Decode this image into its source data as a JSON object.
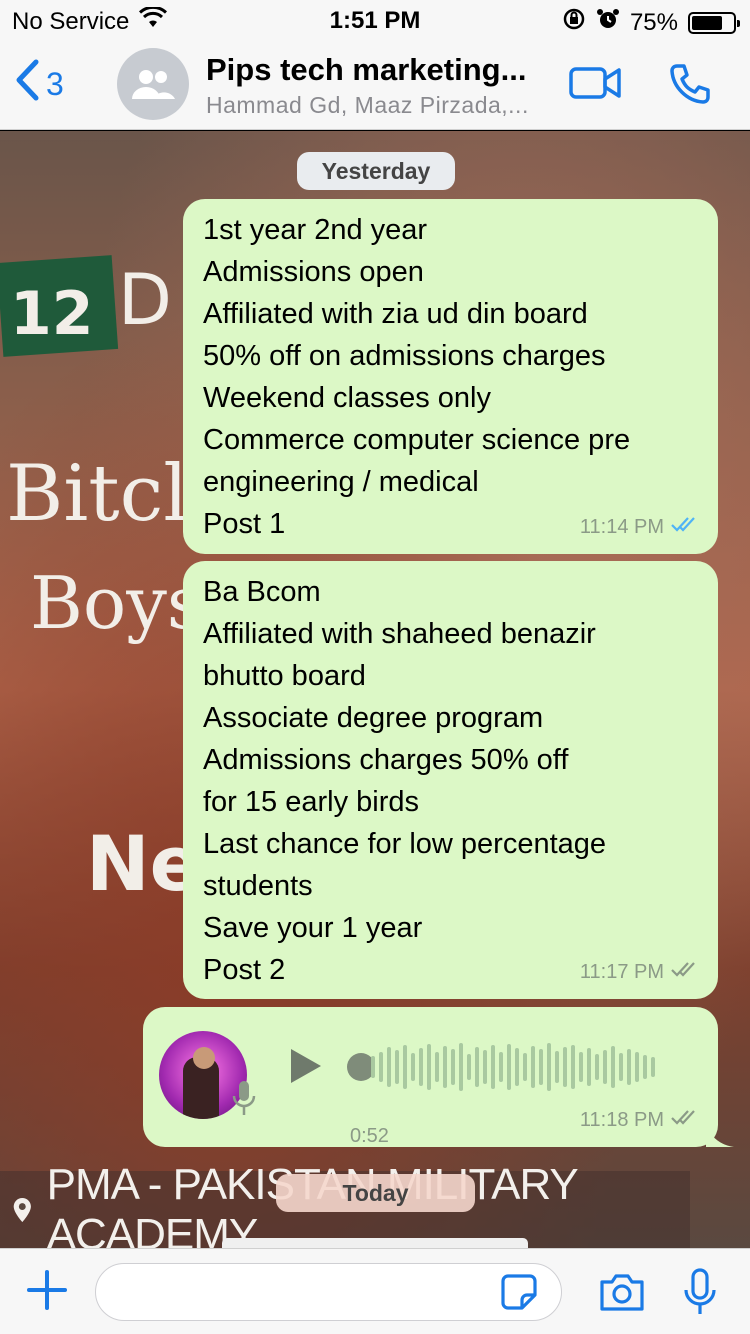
{
  "status_bar": {
    "carrier": "No Service",
    "time": "1:51 PM",
    "battery_percent": "75%",
    "battery_level": 0.75
  },
  "header": {
    "back_count": "3",
    "title": "Pips tech marketing...",
    "subtitle": "Hammad Gd, Maaz Pirzada,..."
  },
  "date_labels": {
    "yesterday": "Yesterday",
    "today": "Today"
  },
  "background": {
    "text_12": "12",
    "text_d": "D",
    "text_bitch": "Bitcl",
    "text_boys": "Boys",
    "text_ne": "Ne",
    "banner": "PMA - PAKISTAN MILITARY ACADEMY"
  },
  "messages": [
    {
      "lines": [
        "1st year 2nd year",
        "Admissions open",
        "Affiliated with zia ud din board",
        "50% off on admissions charges",
        "Weekend classes only",
        "Commerce computer science pre",
        "engineering / medical",
        "Post 1"
      ],
      "time": "11:14 PM",
      "status": "read",
      "tick_color": "#4fb3f6"
    },
    {
      "lines": [
        "Ba Bcom",
        "Affiliated with shaheed benazir",
        "bhutto board",
        "Associate degree program",
        "Admissions charges 50% off",
        "for 15 early birds",
        "Last chance for low percentage",
        "students",
        "Save your 1 year",
        "Post 2"
      ],
      "time": "11:17 PM",
      "status": "delivered",
      "tick_color": "#8b9a87"
    },
    {
      "type": "voice",
      "duration": "0:52",
      "time": "11:18 PM",
      "status": "delivered",
      "tick_color": "#8b9a87"
    }
  ],
  "input": {
    "placeholder": "",
    "value": ""
  },
  "icons": {
    "wifi": "wifi-icon",
    "lock_rotation": "orientation-lock-icon",
    "alarm": "alarm-icon",
    "back": "chevron-left-icon",
    "group": "group-avatar-icon",
    "video": "video-camera-icon",
    "call": "phone-icon",
    "play": "play-icon",
    "mic": "microphone-icon",
    "plus": "plus-icon",
    "sticker": "sticker-icon",
    "camera": "camera-icon"
  },
  "colors": {
    "accent": "#1a7ae6",
    "bubble": "#dcf8c6",
    "read_tick": "#4fb3f6"
  }
}
